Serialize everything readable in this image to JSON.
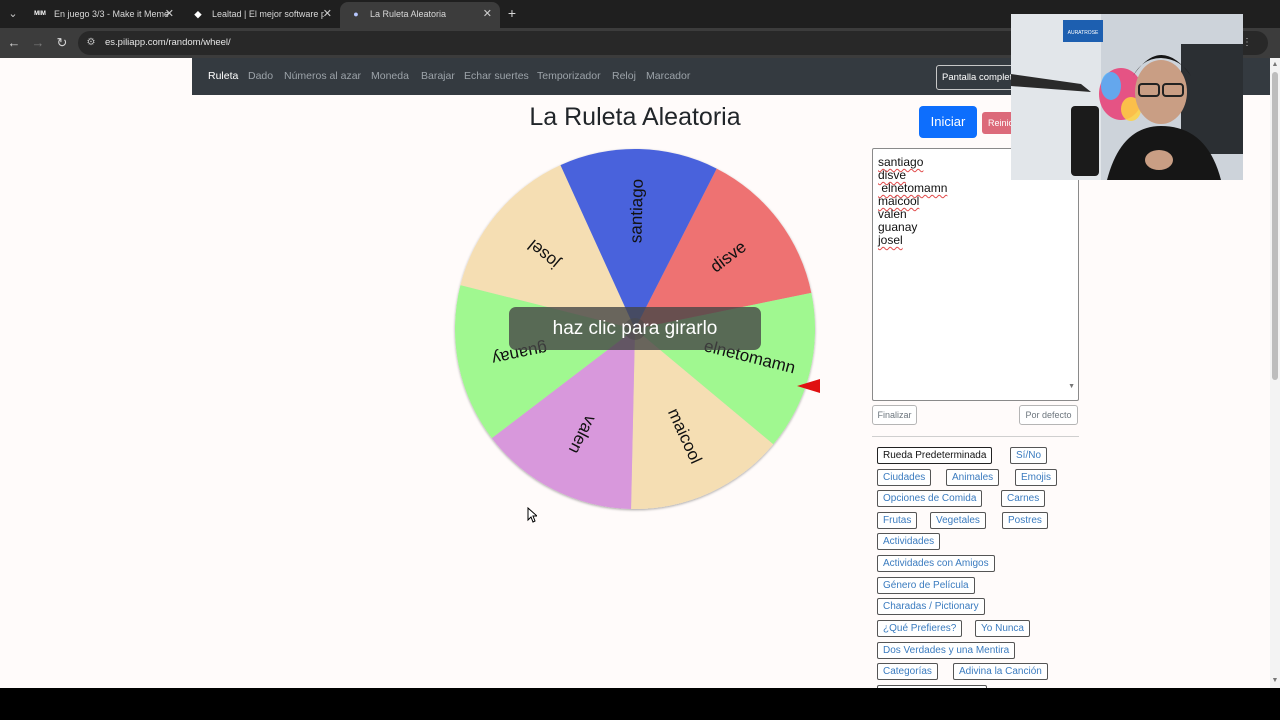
{
  "browser": {
    "tabs": [
      {
        "title": "En juego 3/3 - Make it Meme",
        "favicon": "MIM"
      },
      {
        "title": "Lealtad | El mejor software para",
        "favicon": "◆"
      },
      {
        "title": "La Ruleta Aleatoria",
        "favicon": "●"
      }
    ],
    "url": "es.piliapp.com/random/wheel/"
  },
  "nav": {
    "items": [
      "Ruleta",
      "Dado",
      "Números al azar",
      "Moneda",
      "Barajar",
      "Echar suertes",
      "Temporizador",
      "Reloj",
      "Marcador"
    ],
    "fullscreen_label": "Pantalla completa"
  },
  "main": {
    "title": "La Ruleta Aleatoria",
    "start_label": "Iniciar",
    "reset_label": "Reiniciar",
    "spin_hint": "haz clic para girarlo"
  },
  "wheel": {
    "segments": [
      {
        "label": "disve",
        "color": "#ee7272"
      },
      {
        "label": "elnetomamn",
        "color": "#a0f890"
      },
      {
        "label": "maicool",
        "color": "#f5deb3"
      },
      {
        "label": "valen",
        "color": "#d898dc"
      },
      {
        "label": "guanay",
        "color": "#a0f890"
      },
      {
        "label": "josel",
        "color": "#f5deb3"
      },
      {
        "label": "santiago",
        "color": "#4862dc"
      }
    ],
    "pointer_color": "#e01010"
  },
  "names": {
    "lines": [
      "santiago",
      "disve",
      " elnetomamn",
      "maicool",
      "valen",
      "guanay",
      "josel"
    ],
    "finish_label": "Finalizar",
    "default_label": "Por defecto"
  },
  "presets": {
    "items": [
      "Rueda Predeterminada",
      "Sí/No",
      "Ciudades",
      "Animales",
      "Emojis",
      "Opciones de Comida",
      "Carnes",
      "Frutas",
      "Vegetales",
      "Postres",
      "Actividades",
      "Actividades con Amigos",
      "Género de Película",
      "Charadas / Pictionary",
      "¿Qué Prefieres?",
      "Yo Nunca",
      "Dos Verdades y una Mentira",
      "Categorías",
      "Adivina la Canción"
    ]
  },
  "webcam": {
    "sign_text": "AURATROSE"
  }
}
